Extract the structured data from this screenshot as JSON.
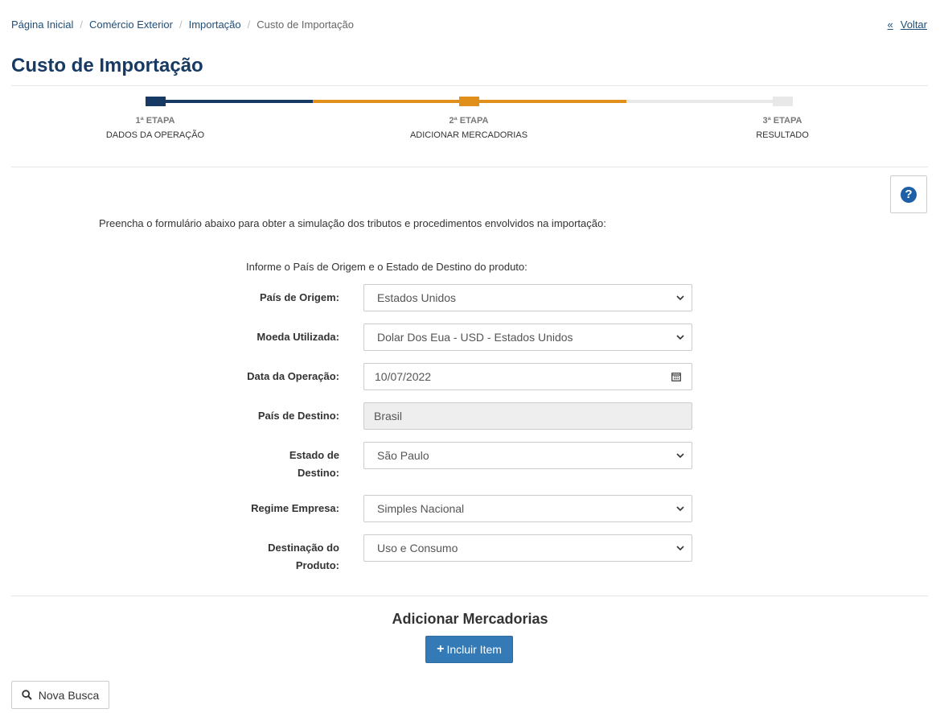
{
  "breadcrumb": {
    "items": [
      "Página Inicial",
      "Comércio Exterior",
      "Importação"
    ],
    "current": "Custo de Importação"
  },
  "back_label": "Voltar",
  "page_title": "Custo de Importação",
  "steps": [
    {
      "num": "1ª ETAPA",
      "label": "DADOS DA OPERAÇÃO",
      "state": "completed",
      "color": "#163a63"
    },
    {
      "num": "2ª ETAPA",
      "label": "ADICIONAR MERCADORIAS",
      "state": "active",
      "color": "#e08f1b"
    },
    {
      "num": "3ª ETAPA",
      "label": "RESULTADO",
      "state": "pending",
      "color": "#e8e8e8"
    }
  ],
  "help_icon": "question-circle-icon",
  "intro_text": "Preencha o formulário abaixo para obter a simulação dos tributos e procedimentos envolvidos na importação:",
  "form": {
    "subtitle": "Informe o País de Origem e o Estado de Destino do produto:",
    "fields": {
      "pais_origem": {
        "label": "País de Origem:",
        "value": "Estados Unidos"
      },
      "moeda": {
        "label": "Moeda Utilizada:",
        "value": "Dolar Dos Eua - USD - Estados Unidos"
      },
      "data_operacao": {
        "label": "Data da Operação:",
        "value": "10/07/2022"
      },
      "pais_destino": {
        "label": "País de Destino:",
        "value": "Brasil"
      },
      "estado_destino": {
        "label_line1": "Estado de",
        "label_line2": "Destino:",
        "value": "São Paulo"
      },
      "regime_empresa": {
        "label": "Regime Empresa:",
        "value": "Simples Nacional"
      },
      "destinacao": {
        "label_line1": "Destinação do",
        "label_line2": "Produto:",
        "value": "Uso e Consumo"
      }
    }
  },
  "section_title": "Adicionar Mercadorias",
  "add_item_label": "Incluir Item",
  "new_search_label": "Nova Busca",
  "colors": {
    "primary": "#163a63",
    "link": "#1f4e79",
    "accent": "#e08f1b",
    "button": "#337ab7"
  }
}
